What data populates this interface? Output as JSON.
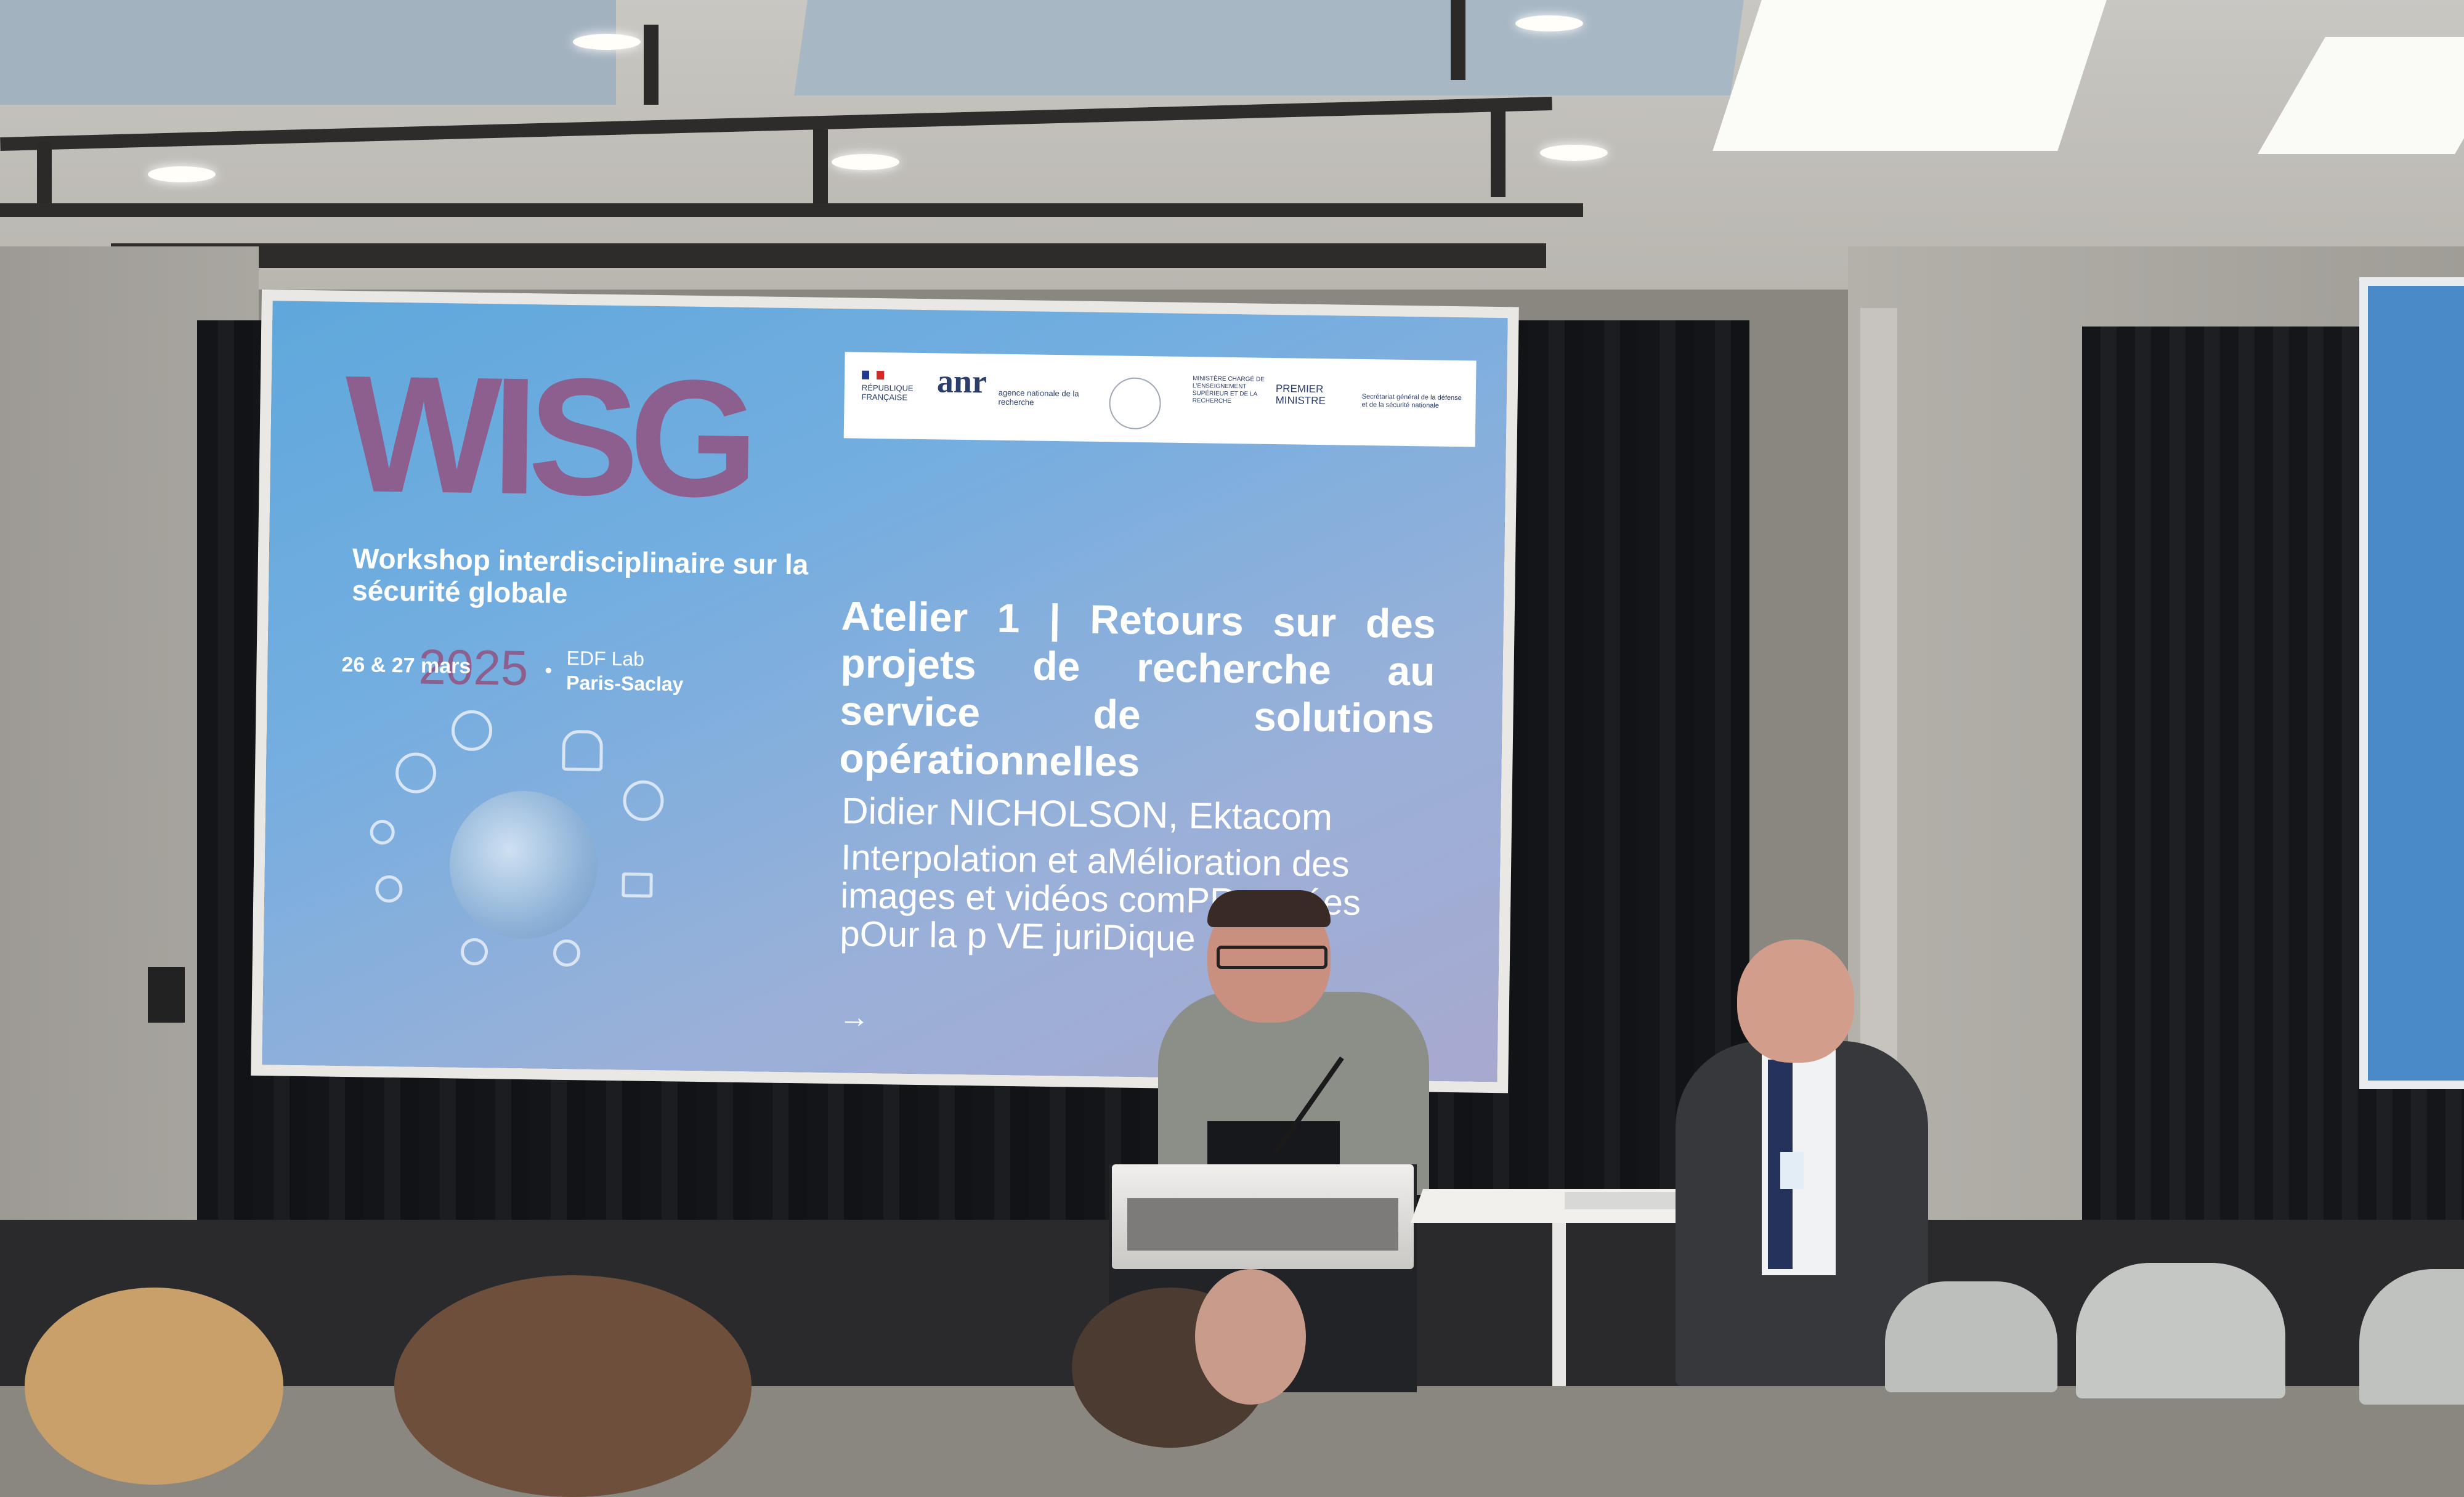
{
  "slide": {
    "logo": "WISG",
    "workshop_title": "Workshop interdisciplinaire sur la sécurité globale",
    "event_date": "26 & 27 mars",
    "event_year": "2025",
    "event_separator": "•",
    "venue_line1": "EDF Lab",
    "venue_line2": "Paris-Saclay",
    "partner_logos": {
      "republique": "RÉPUBLIQUE FRANÇAISE",
      "anr": "anr",
      "anr_caption": "agence nationale de la recherche",
      "ministere": "MINISTÈRE CHARGÉ DE L'ENSEIGNEMENT SUPÉRIEUR ET DE LA RECHERCHE",
      "premier_ministre": "PREMIER MINISTRE",
      "sgdsn": "Secrétariat général de la défense et de la sécurité nationale"
    },
    "atelier_title": "Atelier 1 | Retours sur des projets de recherche au service de solutions opérationnelles",
    "speaker": "Didier NICHOLSON, Ektacom",
    "talk_title": "Interpolation et aMélioration des images et vidéos comPRressées pOur la p     VE juriDique",
    "arrow": "→"
  },
  "colors": {
    "slide_gradient_top": "#5fa8dc",
    "slide_gradient_bottom": "#a8a9cf",
    "logo_purple": "#8c5f8e",
    "curtain": "#141518"
  }
}
